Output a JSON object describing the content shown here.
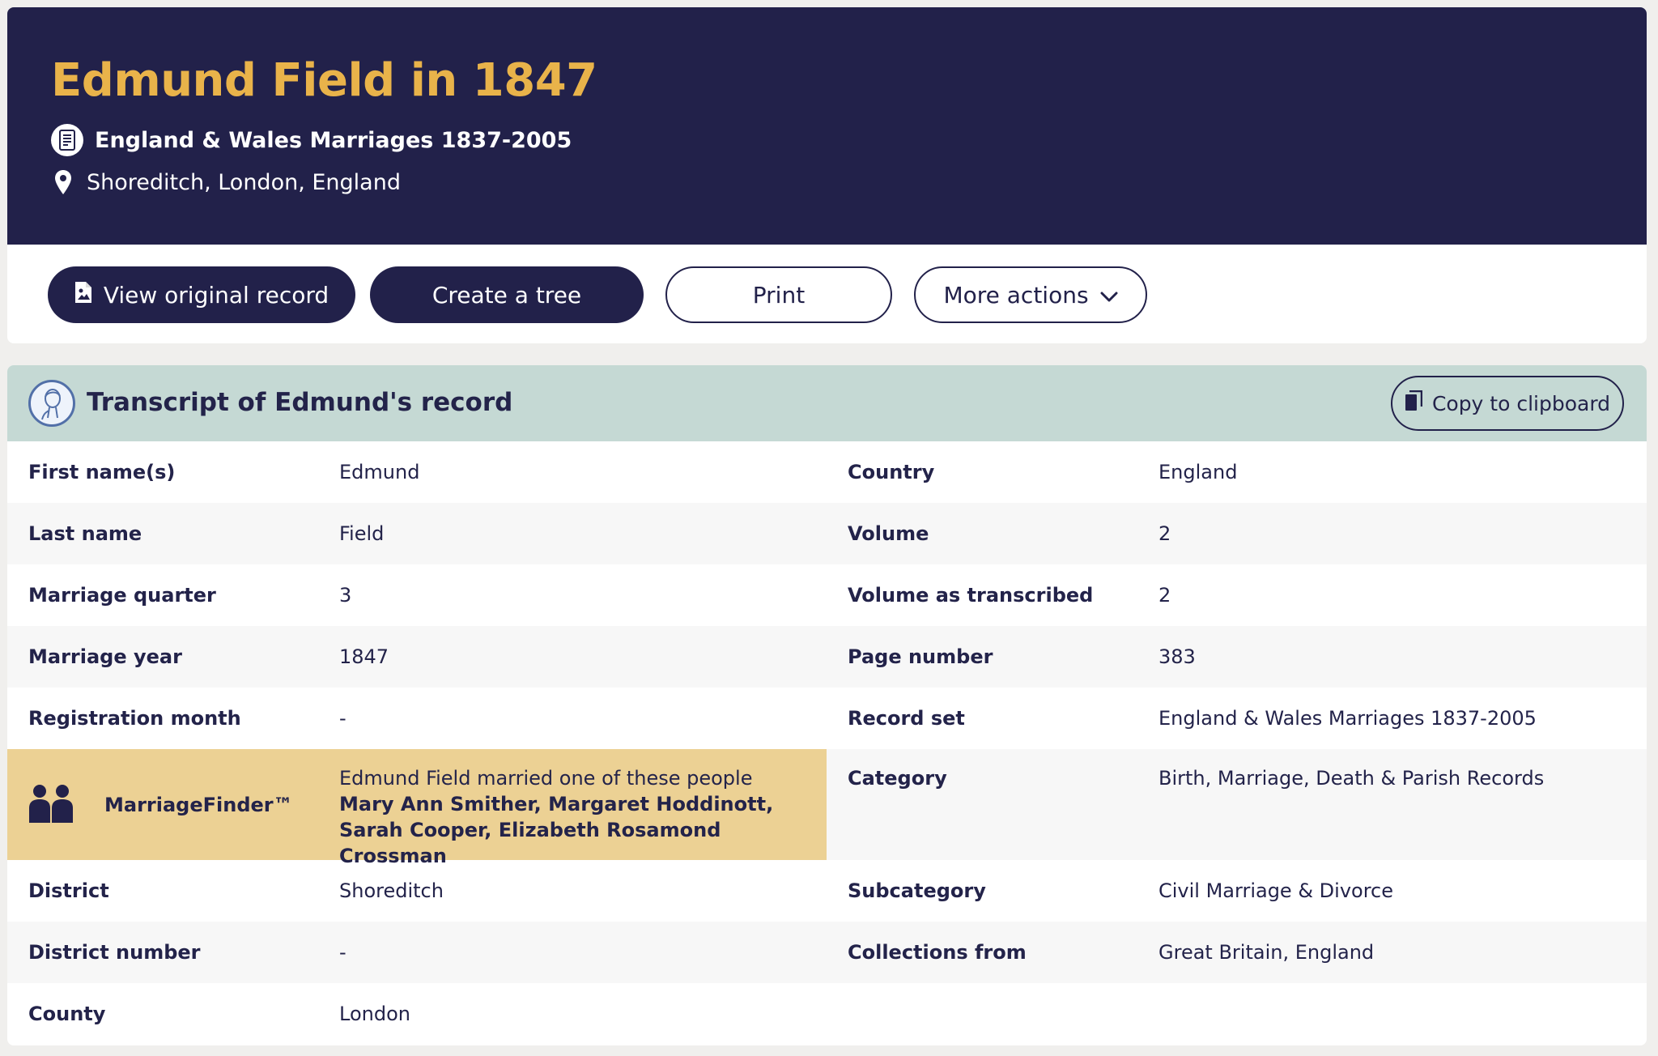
{
  "header": {
    "title": "Edmund Field in 1847",
    "record_source": "England & Wales Marriages 1837-2005",
    "location": "Shoreditch, London, England"
  },
  "actions": {
    "view_original": "View original record",
    "create_tree": "Create a tree",
    "print": "Print",
    "more_actions": "More actions"
  },
  "transcript": {
    "title": "Transcript of Edmund's record",
    "copy_label": "Copy to clipboard",
    "left_rows": [
      {
        "label": "First name(s)",
        "value": "Edmund"
      },
      {
        "label": "Last name",
        "value": "Field"
      },
      {
        "label": "Marriage quarter",
        "value": "3"
      },
      {
        "label": "Marriage year",
        "value": "1847"
      },
      {
        "label": "Registration month",
        "value": "-"
      },
      {
        "label": "District",
        "value": "Shoreditch"
      },
      {
        "label": "District number",
        "value": "-"
      },
      {
        "label": "County",
        "value": "London"
      }
    ],
    "right_rows": [
      {
        "label": "Country",
        "value": "England"
      },
      {
        "label": "Volume",
        "value": "2"
      },
      {
        "label": "Volume as transcribed",
        "value": "2"
      },
      {
        "label": "Page number",
        "value": "383"
      },
      {
        "label": "Record set",
        "value": "England & Wales Marriages 1837-2005"
      },
      {
        "label": "Category",
        "value": "Birth, Marriage, Death & Parish Records"
      },
      {
        "label": "Subcategory",
        "value": "Civil Marriage & Divorce"
      },
      {
        "label": "Collections from",
        "value": "Great Britain, England"
      }
    ],
    "marriage_finder": {
      "label": "MarriageFinder™",
      "intro": "Edmund Field married one of these people",
      "names": "Mary Ann Smither, Margaret Hoddinott, Sarah Cooper, Elizabeth Rosamond Crossman"
    }
  },
  "colors": {
    "navy": "#22214a",
    "gold": "#e9b34a",
    "teal_header": "#c5d9d4",
    "marriage_finder_bg": "#ecd194"
  }
}
